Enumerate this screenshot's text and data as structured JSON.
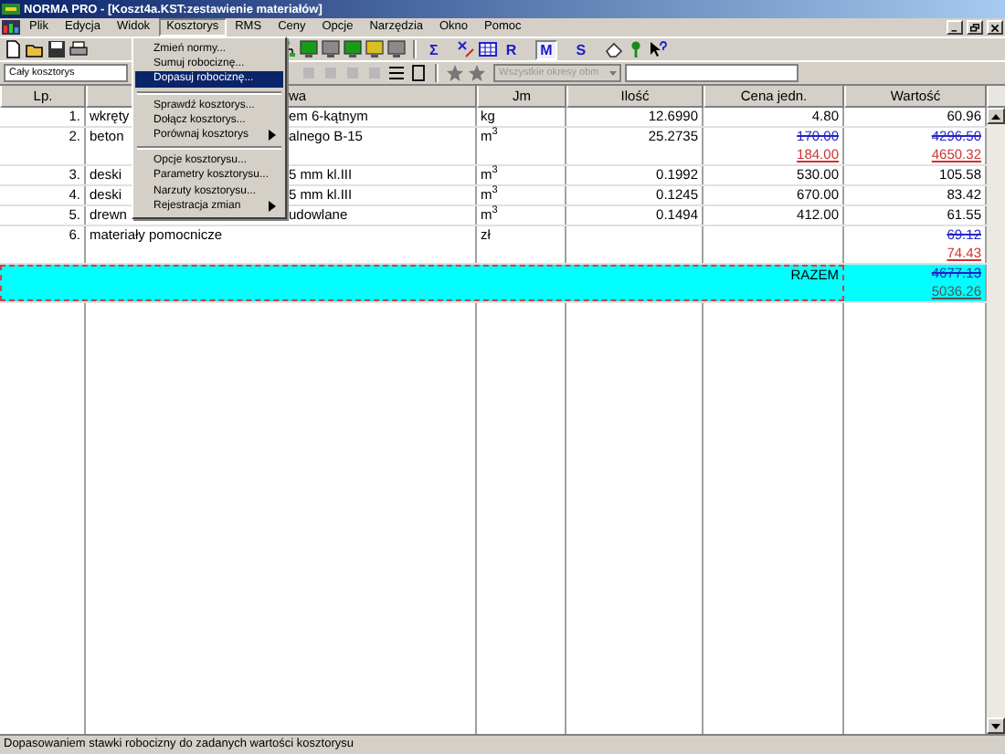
{
  "window": {
    "title": "NORMA PRO - [Koszt4a.KST:zestawienie materiałów]"
  },
  "menu_bar": [
    {
      "label": "Plik",
      "selected": false
    },
    {
      "label": "Edycja",
      "selected": false
    },
    {
      "label": "Widok",
      "selected": false
    },
    {
      "label": "Kosztorys",
      "selected": true
    },
    {
      "label": "RMS",
      "selected": false
    },
    {
      "label": "Ceny",
      "selected": false
    },
    {
      "label": "Opcje",
      "selected": false
    },
    {
      "label": "Narzędzia",
      "selected": false
    },
    {
      "label": "Okno",
      "selected": false
    },
    {
      "label": "Pomoc",
      "selected": false
    }
  ],
  "dropdown_menu": [
    {
      "kind": "item",
      "label": "Zmień normy...",
      "selected": false,
      "submenu": false
    },
    {
      "kind": "item",
      "label": "Sumuj robociznę...",
      "selected": false,
      "submenu": false
    },
    {
      "kind": "item",
      "label": "Dopasuj robociznę...",
      "selected": true,
      "submenu": false
    },
    {
      "kind": "separator"
    },
    {
      "kind": "item",
      "label": "Sprawdź kosztorys...",
      "selected": false,
      "submenu": false
    },
    {
      "kind": "item",
      "label": "Dołącz kosztorys...",
      "selected": false,
      "submenu": false
    },
    {
      "kind": "item",
      "label": "Porównaj kosztorys",
      "selected": false,
      "submenu": true
    },
    {
      "kind": "separator"
    },
    {
      "kind": "item",
      "label": "Opcje kosztorysu...",
      "selected": false,
      "submenu": false
    },
    {
      "kind": "item",
      "label": "Parametry kosztorysu...",
      "selected": false,
      "submenu": false
    },
    {
      "kind": "item",
      "label": "Narzuty kosztorysu...",
      "selected": false,
      "submenu": false
    },
    {
      "kind": "item",
      "label": "Rejestracja zmian",
      "selected": false,
      "submenu": true
    }
  ],
  "toolbar_buttons": [
    {
      "label": "Σ",
      "pressed": false
    },
    {
      "label": "R",
      "pressed": false
    },
    {
      "label": "M",
      "pressed": true
    },
    {
      "label": "S",
      "pressed": false
    }
  ],
  "scope_combo": {
    "value": "Cały kosztorys"
  },
  "period_combo": {
    "value": "Wszystkie okresy obm",
    "disabled": true
  },
  "table": {
    "columns": [
      "Lp.",
      "wa",
      "Jm",
      "Ilość",
      "Cena jedn.",
      "Wartość"
    ],
    "rows": [
      {
        "lp": "1.",
        "name_parts": [
          "wkręty",
          "em 6-kątnym"
        ],
        "jm": "kg",
        "ilosc": "12.6990",
        "cena": [
          {
            "text": "4.80",
            "kind": "plain"
          }
        ],
        "wartosc": [
          {
            "text": "60.96",
            "kind": "plain"
          }
        ]
      },
      {
        "lp": "2.",
        "name_parts": [
          "beton",
          "alnego B-15"
        ],
        "jm": "m$^{3}$",
        "ilosc": "25.2735",
        "cena": [
          {
            "text": "170.00",
            "kind": "old"
          },
          {
            "text": "184.00",
            "kind": "new"
          }
        ],
        "wartosc": [
          {
            "text": "4296.50",
            "kind": "old"
          },
          {
            "text": "4650.32",
            "kind": "new"
          }
        ]
      },
      {
        "lp": "3.",
        "name_parts": [
          "deski",
          "5 mm kl.III"
        ],
        "jm": "m$^{3}$",
        "ilosc": "0.1992",
        "cena": [
          {
            "text": "530.00",
            "kind": "plain"
          }
        ],
        "wartosc": [
          {
            "text": "105.58",
            "kind": "plain"
          }
        ]
      },
      {
        "lp": "4.",
        "name_parts": [
          "deski",
          "5 mm kl.III"
        ],
        "jm": "m$^{3}$",
        "ilosc": "0.1245",
        "cena": [
          {
            "text": "670.00",
            "kind": "plain"
          }
        ],
        "wartosc": [
          {
            "text": "83.42",
            "kind": "plain"
          }
        ]
      },
      {
        "lp": "5.",
        "name_parts": [
          "drewn",
          "udowlane"
        ],
        "jm": "m$^{3}$",
        "ilosc": "0.1494",
        "cena": [
          {
            "text": "412.00",
            "kind": "plain"
          }
        ],
        "wartosc": [
          {
            "text": "61.55",
            "kind": "plain"
          }
        ]
      },
      {
        "lp": "6.",
        "name_parts": [
          "materiały pomocnicze"
        ],
        "jm": "zł",
        "ilosc": "",
        "cena": [],
        "wartosc": [
          {
            "text": "69.12",
            "kind": "old"
          },
          {
            "text": "74.43",
            "kind": "new"
          }
        ]
      }
    ],
    "total": {
      "label": "RAZEM",
      "wartosc": [
        {
          "text": "4677.13",
          "kind": "old"
        },
        {
          "text": "5036.26",
          "kind": "total"
        }
      ]
    }
  },
  "status_bar": "Dopasowaniem stawki robocizny do zadanych wartości kosztorysu"
}
